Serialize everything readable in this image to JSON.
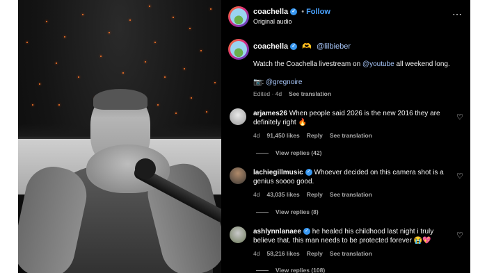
{
  "post": {
    "author": "coachella",
    "dot": "•",
    "follow_label": "Follow",
    "audio": "Original audio",
    "more_icon": "more-horizontal-icon"
  },
  "caption": {
    "author": "coachella",
    "collab_emoji": "🫶",
    "mention": "@lilbieber",
    "line1_prefix": "Watch the Coachella livestream on ",
    "line1_mention": "@youtube",
    "line1_suffix": " all weekend long.",
    "credit_prefix": "📷: ",
    "credit_mention": "@gregnoire",
    "edited": "Edited · 4d",
    "see_translation": "See translation"
  },
  "comments": [
    {
      "username": "arjames26",
      "verified": false,
      "line1": "When people said 2026 is the new 2016 they are",
      "line2": "definitely right 🔥",
      "age": "4d",
      "likes": "91,450 likes",
      "reply": "Reply",
      "translate": "See translation",
      "view_replies": "View replies (42)"
    },
    {
      "username": "lachiegillmusic",
      "verified": true,
      "line1": "Whoever decided on this camera shot is a",
      "line2": "genius soooo good.",
      "age": "4d",
      "likes": "43,035 likes",
      "reply": "Reply",
      "translate": "See translation",
      "view_replies": "View replies (8)"
    },
    {
      "username": "ashlynnlanaee",
      "verified": true,
      "line1": "he healed his childhood last night i truly",
      "line2": "believe that. this man needs to be protected forever 😭💖",
      "age": "4d",
      "likes": "58,216 likes",
      "reply": "Reply",
      "translate": "See translation",
      "view_replies": "View replies (108)"
    }
  ],
  "colors": {
    "panel_bg": "#000000",
    "text": "#f5f5f5",
    "muted": "#a8a8a8",
    "link": "#a8c7fa",
    "follow": "#4aa3ff",
    "verified": "#3897f0"
  }
}
